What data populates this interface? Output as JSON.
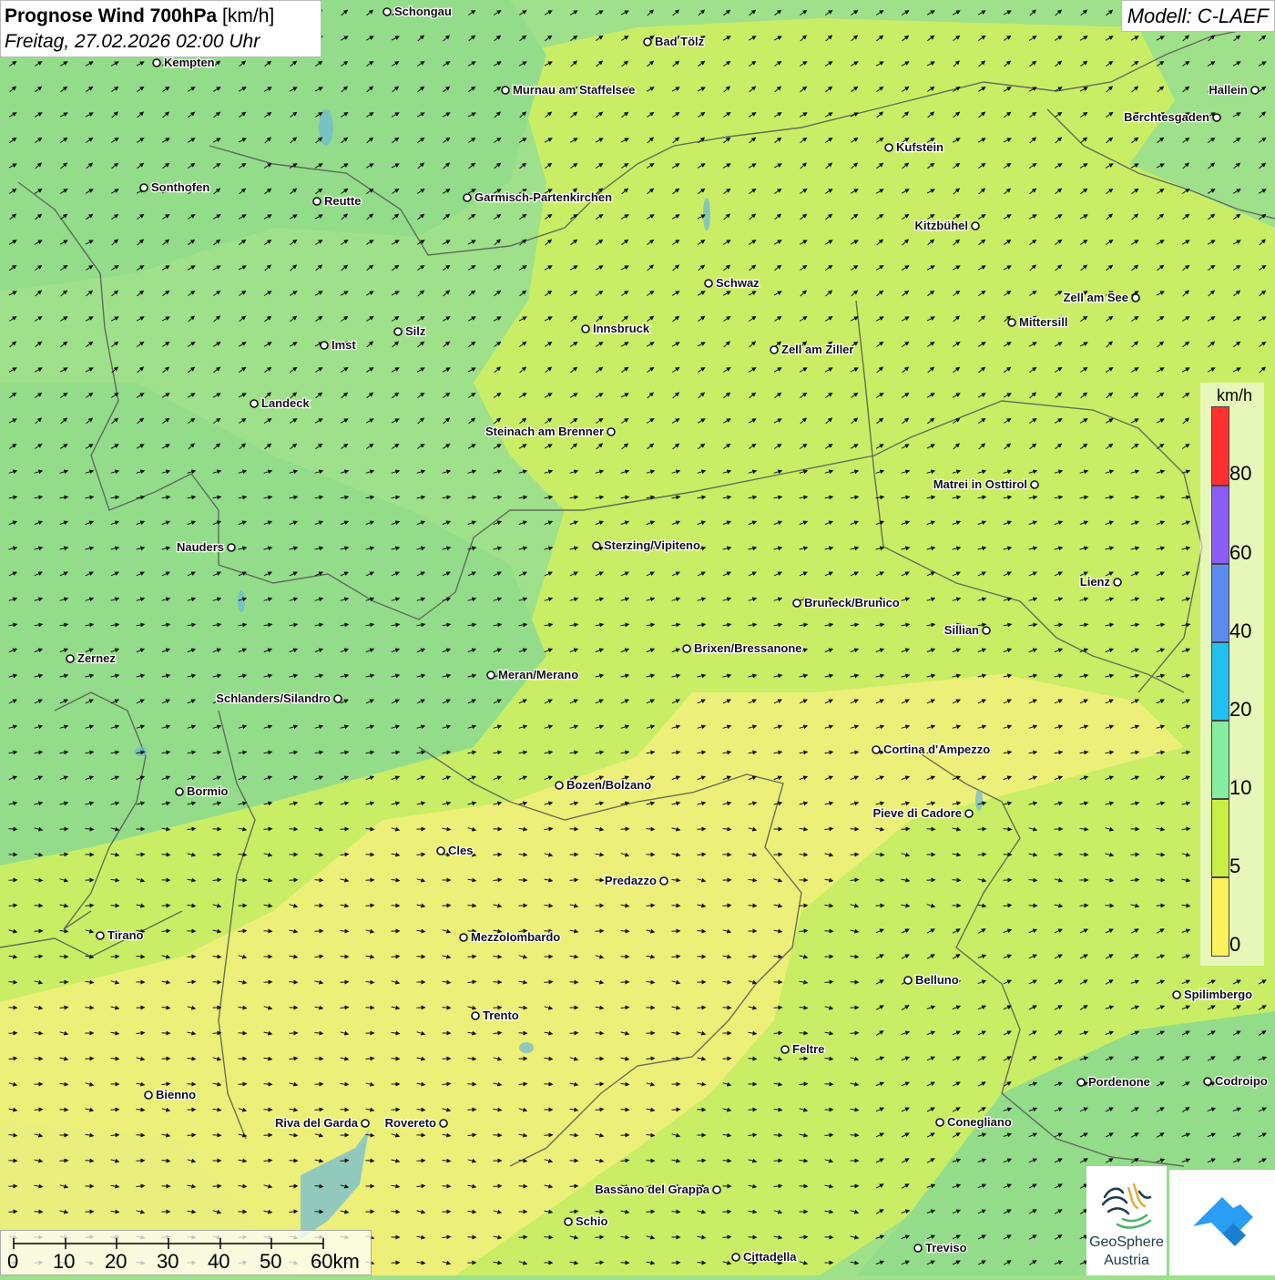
{
  "title": {
    "main_bold": "Prognose Wind 700hPa",
    "unit": "[km/h]",
    "datetime": "Freitag, 27.02.2026 02:00 Uhr"
  },
  "model": "Modell: C-LAEF",
  "legend": {
    "unit": "km/h",
    "labels": [
      "80",
      "60",
      "40",
      "20",
      "10",
      "5",
      "0"
    ],
    "colors": [
      "#ff2d2d",
      "#8b5cf6",
      "#5b8def",
      "#22c0f0",
      "#86eea0",
      "#c9ee44",
      "#fbf25c"
    ]
  },
  "scale": {
    "labels": [
      "0",
      "10",
      "20",
      "30",
      "40",
      "50",
      "60km"
    ]
  },
  "cities": [
    {
      "name": "Schongau"
    },
    {
      "name": "Bad Tölz"
    },
    {
      "name": "Kempten"
    },
    {
      "name": "Murnau am Staffelsee"
    },
    {
      "name": "Hallein"
    },
    {
      "name": "Berchtesgaden"
    },
    {
      "name": "Kufstein"
    },
    {
      "name": "Sonthofen"
    },
    {
      "name": "Reutte"
    },
    {
      "name": "Garmisch-Partenkirchen"
    },
    {
      "name": "Kitzbühel"
    },
    {
      "name": "Schwaz"
    },
    {
      "name": "Zell am See"
    },
    {
      "name": "Mittersill"
    },
    {
      "name": "Silz"
    },
    {
      "name": "Innsbruck"
    },
    {
      "name": "Imst"
    },
    {
      "name": "Zell am Ziller"
    },
    {
      "name": "Landeck"
    },
    {
      "name": "Steinach am Brenner"
    },
    {
      "name": "Matrei in Osttirol"
    },
    {
      "name": "Nauders"
    },
    {
      "name": "Sterzing/Vipiteno"
    },
    {
      "name": "Lienz"
    },
    {
      "name": "Bruneck/Brunico"
    },
    {
      "name": "Sillian"
    },
    {
      "name": "Brixen/Bressanone"
    },
    {
      "name": "Zernez"
    },
    {
      "name": "Meran/Merano"
    },
    {
      "name": "Schlanders/Silandro"
    },
    {
      "name": "Cortina d'Ampezzo"
    },
    {
      "name": "Bozen/Bolzano"
    },
    {
      "name": "Bormio"
    },
    {
      "name": "Pieve di Cadore"
    },
    {
      "name": "Cles"
    },
    {
      "name": "Predazzo"
    },
    {
      "name": "Tirano"
    },
    {
      "name": "Mezzolombardo"
    },
    {
      "name": "Belluno"
    },
    {
      "name": "Spilimbergo"
    },
    {
      "name": "Trento"
    },
    {
      "name": "Feltre"
    },
    {
      "name": "Pordenone"
    },
    {
      "name": "Codroipo"
    },
    {
      "name": "Bienno"
    },
    {
      "name": "Riva del Garda"
    },
    {
      "name": "Rovereto"
    },
    {
      "name": "Conegliano"
    },
    {
      "name": "Bassano del Grappa"
    },
    {
      "name": "Schio"
    },
    {
      "name": "Treviso"
    },
    {
      "name": "Cittadella"
    }
  ],
  "logos": {
    "geosphere_name": "GeoSphere",
    "geosphere_sub": "Austria",
    "geosphere_icon": "geosphere-logo-icon",
    "app_icon": "mountain-app-icon"
  },
  "field_colors": {
    "green": "#9fe08a",
    "green_yellow": "#c9ee66",
    "yellow": "#f2f27a"
  }
}
